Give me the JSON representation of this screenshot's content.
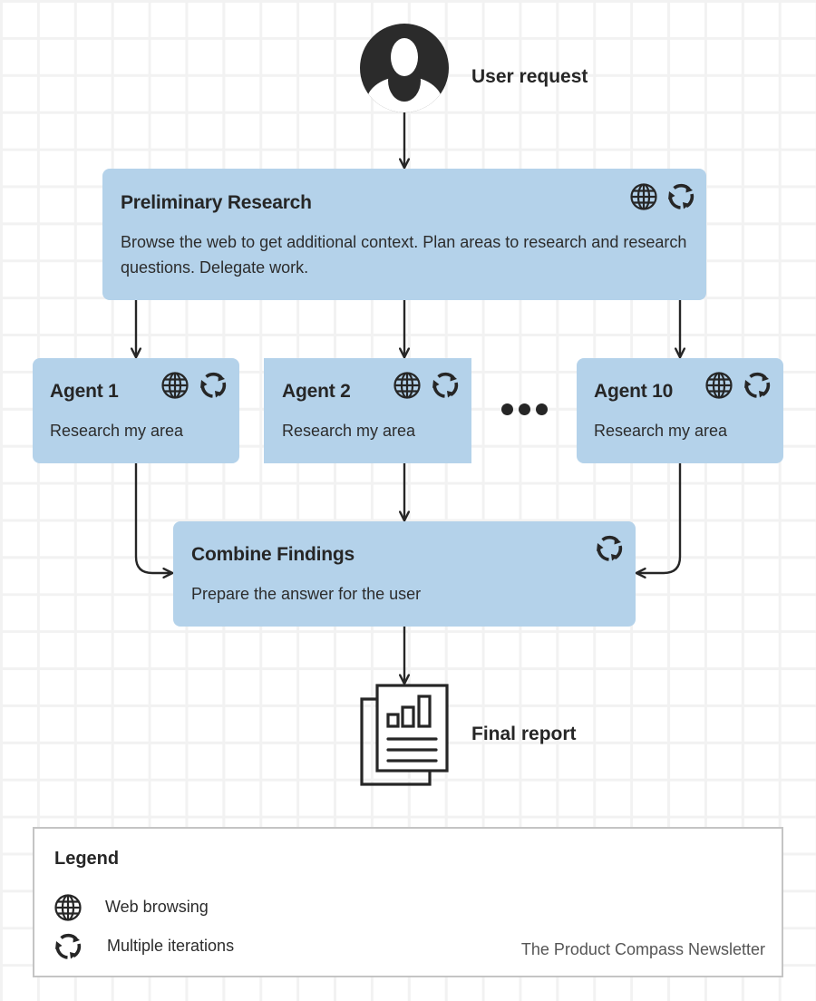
{
  "user": {
    "label": "User request",
    "icon": "user-avatar-icon"
  },
  "preliminary": {
    "title": "Preliminary Research",
    "description": "Browse the web to get additional context. Plan areas to research and research questions. Delegate work.",
    "icons": [
      "globe-icon",
      "cycle-icon"
    ]
  },
  "agents": [
    {
      "title": "Agent 1",
      "description": "Research my area",
      "icons": [
        "globe-icon",
        "cycle-icon"
      ]
    },
    {
      "title": "Agent 2",
      "description": "Research my area",
      "icons": [
        "globe-icon",
        "cycle-icon"
      ]
    },
    {
      "title": "Agent 10",
      "description": "Research my area",
      "icons": [
        "globe-icon",
        "cycle-icon"
      ]
    }
  ],
  "ellipsis": "more-agents",
  "combine": {
    "title": "Combine Findings",
    "description": "Prepare the answer for the user",
    "icons": [
      "cycle-icon"
    ]
  },
  "report": {
    "label": "Final report",
    "icon": "report-document-icon"
  },
  "legend": {
    "title": "Legend",
    "items": [
      {
        "icon": "globe-icon",
        "label": "Web browsing"
      },
      {
        "icon": "cycle-icon",
        "label": "Multiple iterations"
      }
    ],
    "credit": "The Product Compass Newsletter"
  },
  "colors": {
    "box_fill": "#b4d2ea",
    "ink": "#262626",
    "grid": "#f2f2f2",
    "legend_border": "#c4c4c4"
  }
}
